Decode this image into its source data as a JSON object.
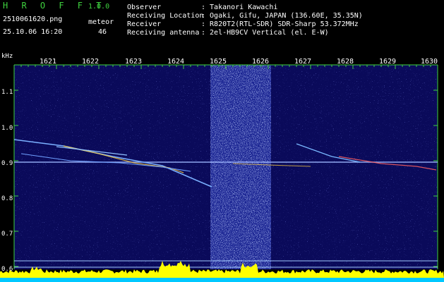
{
  "header": {
    "app_title": "H R O F F T",
    "app_version": "1.0.0",
    "file_name": "2510061620.png",
    "date_time": "25.10.06 16:20",
    "meteor_label": "meteor",
    "meteor_count": "46",
    "info": [
      {
        "key": "Observer",
        "value": ": Takanori Kawachi"
      },
      {
        "key": "Receiving Location",
        "value": ": Ogaki, Gifu, JAPAN (136.60E, 35.35N)"
      },
      {
        "key": "Receiver",
        "value": ": R820T2(RTL-SDR) SDR-Sharp 53.372MHz"
      },
      {
        "key": "Receiving antenna",
        "value": ": 2el-HB9CV Vertical (el. E-W)"
      }
    ]
  },
  "spectrogram": {
    "y_unit": "kHz",
    "x_ticks": [
      "1621",
      "1622",
      "1623",
      "1624",
      "1625",
      "1626",
      "1627",
      "1628",
      "1629",
      "1630"
    ],
    "y_ticks": [
      "1.1",
      "1.0",
      "0.9",
      "0.8",
      "0.7",
      "0.6"
    ],
    "colors": {
      "background": "#0a0a5a",
      "ticks": "#3fd23f",
      "histogram": "#ffff00",
      "baseline": "#00c8ff",
      "reference": "#a0c8ff"
    }
  }
}
